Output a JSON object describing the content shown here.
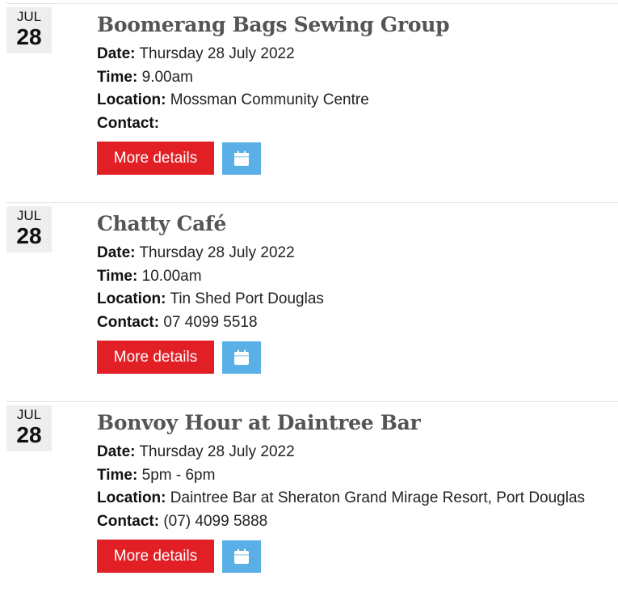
{
  "events": [
    {
      "month": "JUL",
      "day": "28",
      "title": "Boomerang Bags Sewing Group",
      "date_label": "Date:",
      "date": "Thursday 28 July 2022",
      "time_label": "Time:",
      "time": "9.00am",
      "location_label": "Location:",
      "location": "Mossman Community Centre",
      "contact_label": "Contact:",
      "contact": "",
      "button_label": "More details",
      "calendar_icon": "calendar-icon"
    },
    {
      "month": "JUL",
      "day": "28",
      "title": "Chatty Café",
      "date_label": "Date:",
      "date": "Thursday 28 July 2022",
      "time_label": "Time:",
      "time": "10.00am",
      "location_label": "Location:",
      "location": "Tin Shed Port Douglas",
      "contact_label": "Contact:",
      "contact": "07 4099 5518",
      "button_label": "More details",
      "calendar_icon": "calendar-icon"
    },
    {
      "month": "JUL",
      "day": "28",
      "title": "Bonvoy Hour at Daintree Bar",
      "date_label": "Date:",
      "date": "Thursday 28 July 2022",
      "time_label": "Time:",
      "time": "5pm - 6pm",
      "location_label": "Location:",
      "location": "Daintree Bar at Sheraton Grand Mirage Resort, Port Douglas",
      "contact_label": "Contact:",
      "contact": "(07) 4099 5888",
      "button_label": "More details",
      "calendar_icon": "calendar-icon"
    }
  ],
  "colors": {
    "button_red": "#e11f25",
    "calendar_blue": "#5ab0e6",
    "title_gray": "#555555",
    "date_box_bg": "#eeeeee"
  }
}
